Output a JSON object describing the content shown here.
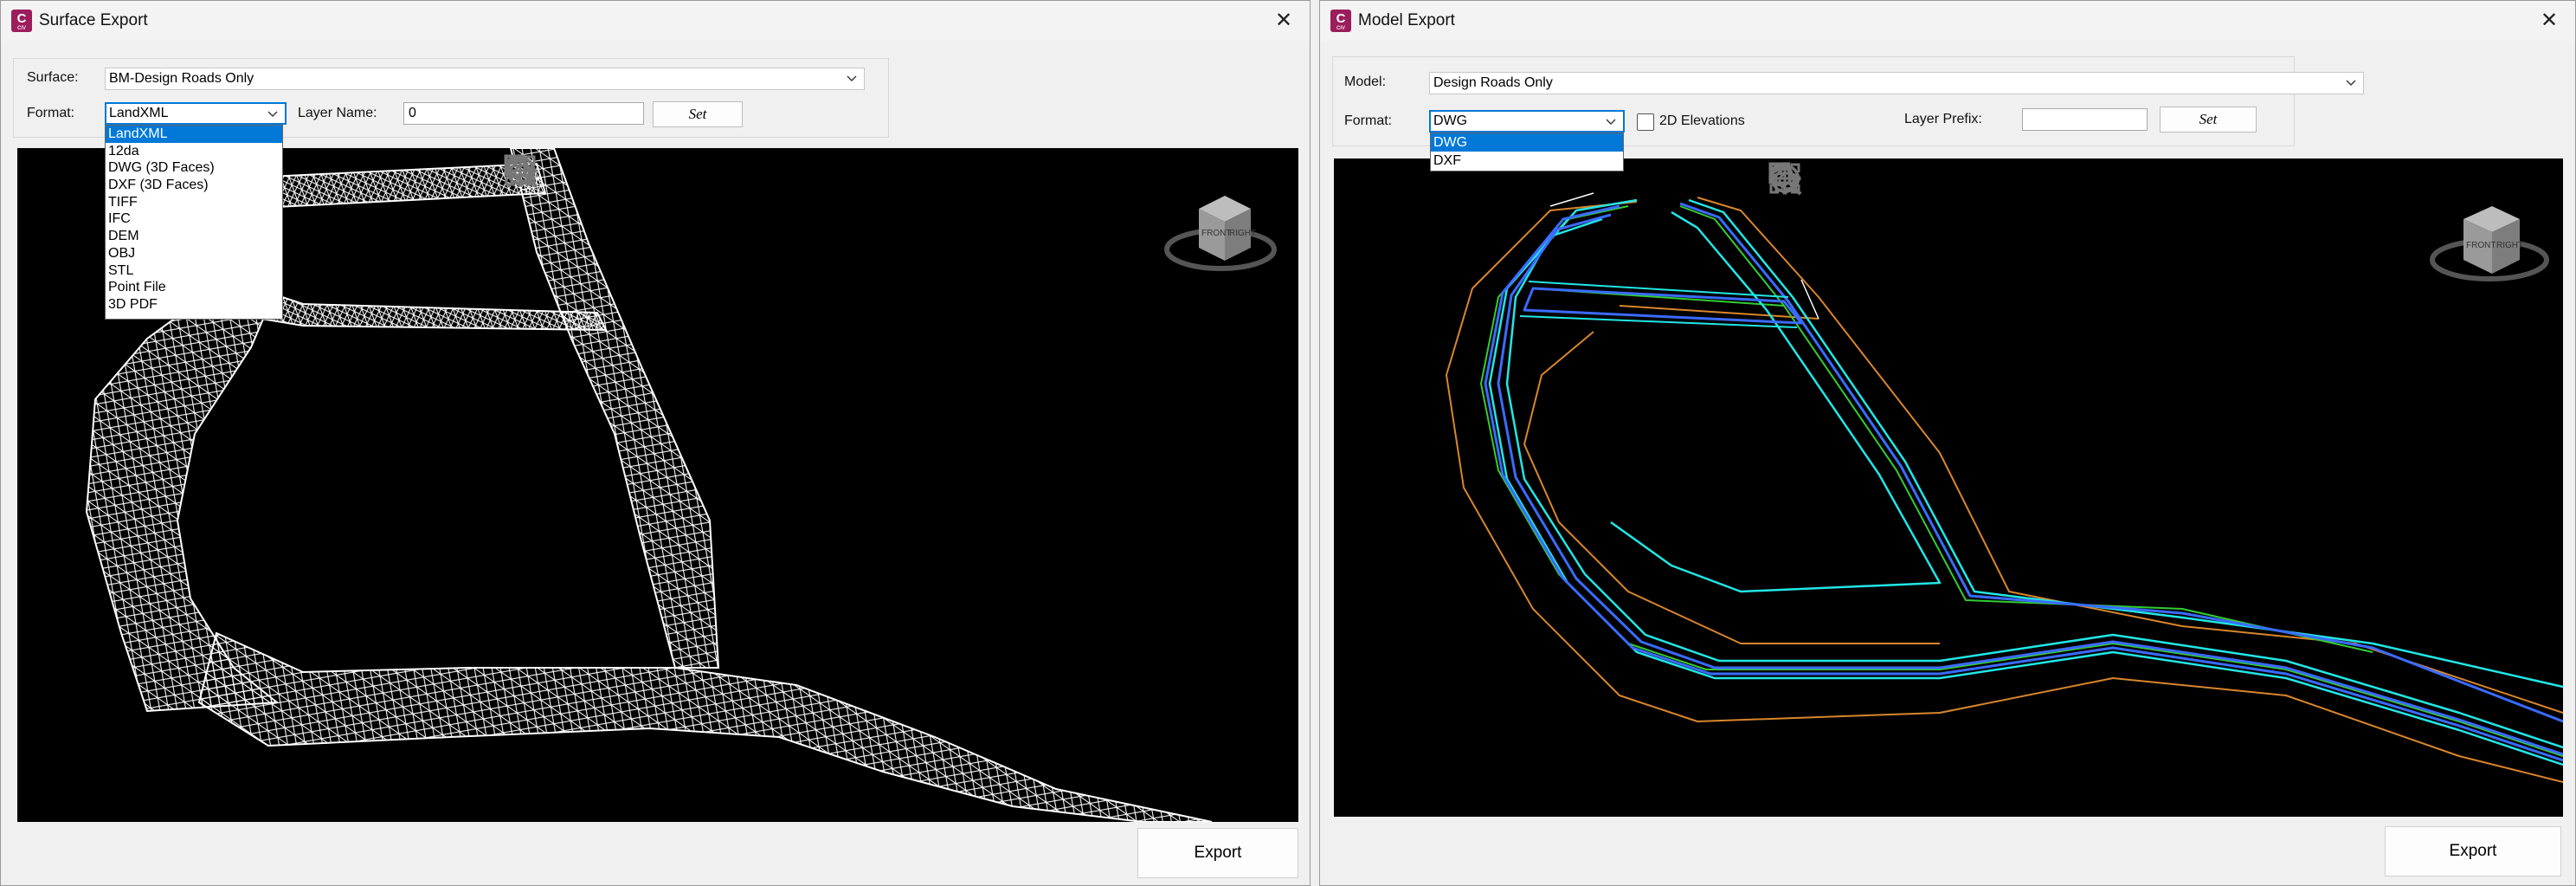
{
  "surface_export": {
    "title": "Surface Export",
    "close": "✕",
    "surface_label": "Surface:",
    "surface_value": "BM-Design Roads Only",
    "format_label": "Format:",
    "format_value": "LandXML",
    "layer_name_label": "Layer Name:",
    "layer_name_value": "0",
    "set_label": "Set",
    "format_options": [
      "LandXML",
      "12da",
      "DWG (3D Faces)",
      "DXF (3D Faces)",
      "TIFF",
      "IFC",
      "DEM",
      "OBJ",
      "STL",
      "Point File",
      "3D PDF"
    ],
    "export_label": "Export",
    "cube_front": "FRONT",
    "cube_right": "RIGHT"
  },
  "model_export": {
    "title": "Model Export",
    "close": "✕",
    "model_label": "Model:",
    "model_value": "Design Roads Only",
    "format_label": "Format:",
    "format_value": "DWG",
    "elevations_label": "2D Elevations",
    "layer_prefix_label": "Layer Prefix:",
    "layer_prefix_value": "",
    "set_label": "Set",
    "format_options": [
      "DWG",
      "DXF"
    ],
    "export_label": "Export",
    "cube_front": "FRONT",
    "cube_right": "RIGHT"
  },
  "colors": {
    "accent": "#0078d7",
    "app_icon": "#9c1d5c",
    "viewport_bg": "#000000",
    "mesh": "#ffffff",
    "line_blue": "#3a6bff",
    "line_cyan": "#22e6e6",
    "line_green": "#33cc33",
    "line_orange": "#d9862b"
  }
}
